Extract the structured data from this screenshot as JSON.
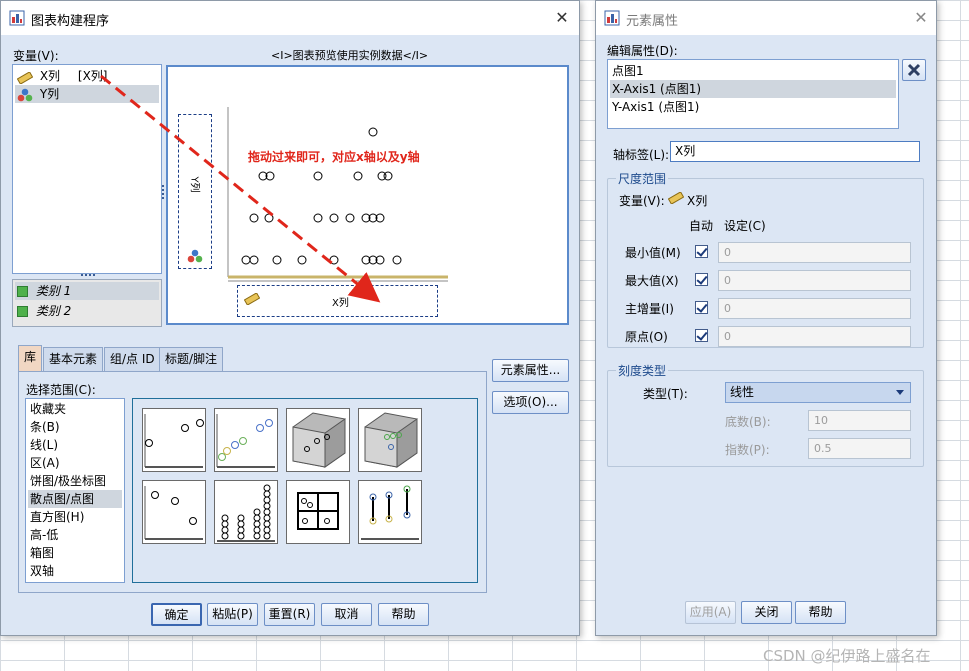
{
  "chart_builder": {
    "title": "图表构建程序",
    "variables_label": "变量(V):",
    "variables": [
      {
        "name": "X列",
        "tag": "[X列]",
        "icon": "ruler-icon"
      },
      {
        "name": "Y列",
        "icon": "nominal-circles-icon"
      }
    ],
    "categories": [
      "类别 1",
      "类别 2"
    ],
    "preview_title": "<I>图表预览使用实例数据</I>",
    "y_drop_label": "Y列",
    "x_drop_label": "X列",
    "annotation": "拖动过来即可，对应x轴以及y轴",
    "tabs": [
      "库",
      "基本元素",
      "组/点 ID",
      "标题/脚注"
    ],
    "choose_from_label": "选择范围(C):",
    "chart_types": [
      "收藏夹",
      "条(B)",
      "线(L)",
      "区(A)",
      "饼图/极坐标图",
      "散点图/点图",
      "直方图(H)",
      "高-低",
      "箱图",
      "双轴"
    ],
    "selected_chart_type": "散点图/点图",
    "element_properties_button": "元素属性...",
    "options_button": "选项(O)...",
    "buttons": {
      "ok": "确定",
      "paste": "粘贴(P)",
      "reset": "重置(R)",
      "cancel": "取消",
      "help": "帮助"
    },
    "gallery": [
      "simple-scatter",
      "grouped-scatter",
      "simple-3d-scatter",
      "grouped-3d-scatter",
      "summary-point",
      "simple-dot",
      "scatterplot-matrix",
      "drop-line"
    ]
  },
  "element_properties": {
    "title": "元素属性",
    "edit_properties_label": "编辑属性(D):",
    "items": [
      "点图1",
      "X-Axis1 (点图1)",
      "Y-Axis1 (点图1)"
    ],
    "selected_item": "X-Axis1 (点图1)",
    "axis_label_label": "轴标签(L):",
    "axis_label_value": "X列",
    "scale_range_title": "尺度范围",
    "variable_label": "变量(V):",
    "variable_value": "X列",
    "auto_header": "自动",
    "custom_header": "设定(C)",
    "rows": [
      {
        "label": "最小值(M)",
        "auto": true,
        "value": "0"
      },
      {
        "label": "最大值(X)",
        "auto": true,
        "value": "0"
      },
      {
        "label": "主增量(I)",
        "auto": true,
        "value": "0"
      },
      {
        "label": "原点(O)",
        "auto": true,
        "value": "0"
      }
    ],
    "scale_type_title": "刻度类型",
    "type_label": "类型(T):",
    "type_value": "线性",
    "base_label": "底数(B):",
    "base_value": "10",
    "exponent_label": "指数(P):",
    "exponent_value": "0.5",
    "buttons": {
      "apply": "应用(A)",
      "close": "关闭",
      "help": "帮助"
    }
  },
  "watermark": "CSDN @纪伊路上盛名在",
  "colors": {
    "accent": "#dce6f4",
    "arrow": "#e0261b",
    "annotation": "#e0261b"
  }
}
